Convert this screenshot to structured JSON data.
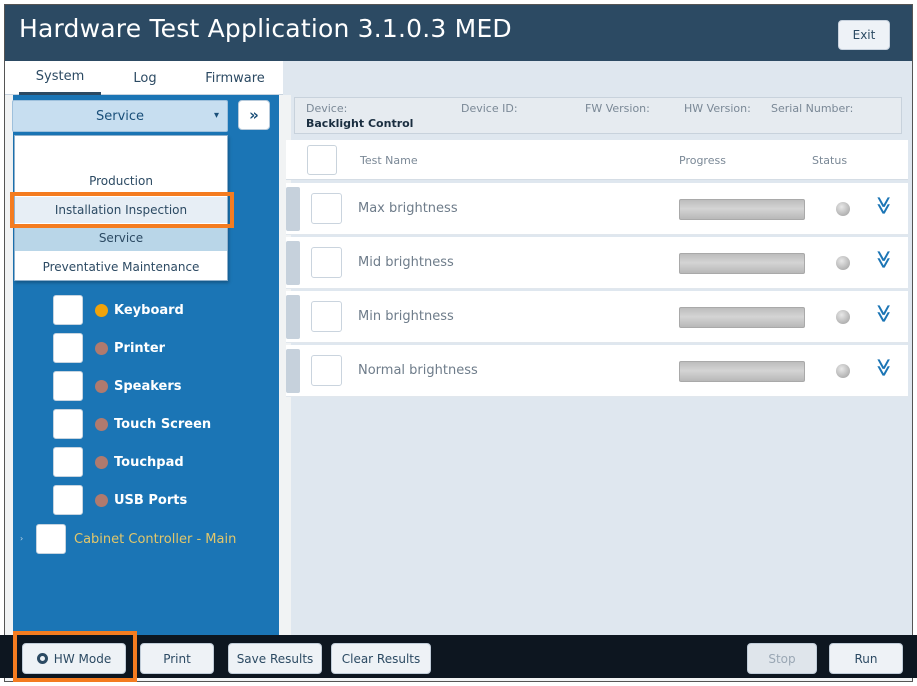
{
  "app": {
    "title": "Hardware Test Application 3.1.0.3 MED",
    "exit_label": "Exit"
  },
  "tabs": [
    {
      "label": "System",
      "active": true
    },
    {
      "label": "Log",
      "active": false
    },
    {
      "label": "Firmware",
      "active": false
    }
  ],
  "mode_select": {
    "value": "Service"
  },
  "mode_dropdown": {
    "options": [
      "Production",
      "Installation Inspection",
      "Service",
      "Preventative Maintenance"
    ],
    "selected": "Service",
    "highlighted": "Installation Inspection"
  },
  "expand_icon": "double-chevron-right-icon",
  "device_tree": [
    {
      "label": "Keyboard",
      "status_color": "#f0a30a"
    },
    {
      "label": "Printer",
      "status_color": "#b07a6e"
    },
    {
      "label": "Speakers",
      "status_color": "#b07a6e"
    },
    {
      "label": "Touch Screen",
      "status_color": "#b07a6e"
    },
    {
      "label": "Touchpad",
      "status_color": "#b07a6e"
    },
    {
      "label": "USB Ports",
      "status_color": "#b07a6e"
    }
  ],
  "cabinet_controller": {
    "label": "Cabinet Controller - Main"
  },
  "device_info": {
    "device_label": "Device:",
    "device_value": "Backlight Control",
    "device_id_label": "Device ID:",
    "fw_version_label": "FW Version:",
    "hw_version_label": "HW Version:",
    "serial_number_label": "Serial Number:"
  },
  "test_table": {
    "columns": {
      "name": "Test Name",
      "progress": "Progress",
      "status": "Status"
    },
    "rows": [
      {
        "name": "Max brightness",
        "progress": 0,
        "status": "idle"
      },
      {
        "name": "Mid brightness",
        "progress": 0,
        "status": "idle"
      },
      {
        "name": "Min brightness",
        "progress": 0,
        "status": "idle"
      },
      {
        "name": "Normal brightness",
        "progress": 0,
        "status": "idle"
      }
    ]
  },
  "footer": {
    "hw_mode_label": "HW Mode",
    "print_label": "Print",
    "save_results_label": "Save Results",
    "clear_results_label": "Clear Results",
    "stop_label": "Stop",
    "run_label": "Run"
  },
  "colors": {
    "header": "#2c4a63",
    "left_panel": "#1b75b5",
    "highlight": "#f47c20",
    "status_active": "#f0a30a",
    "status_inactive": "#b07a6e"
  }
}
